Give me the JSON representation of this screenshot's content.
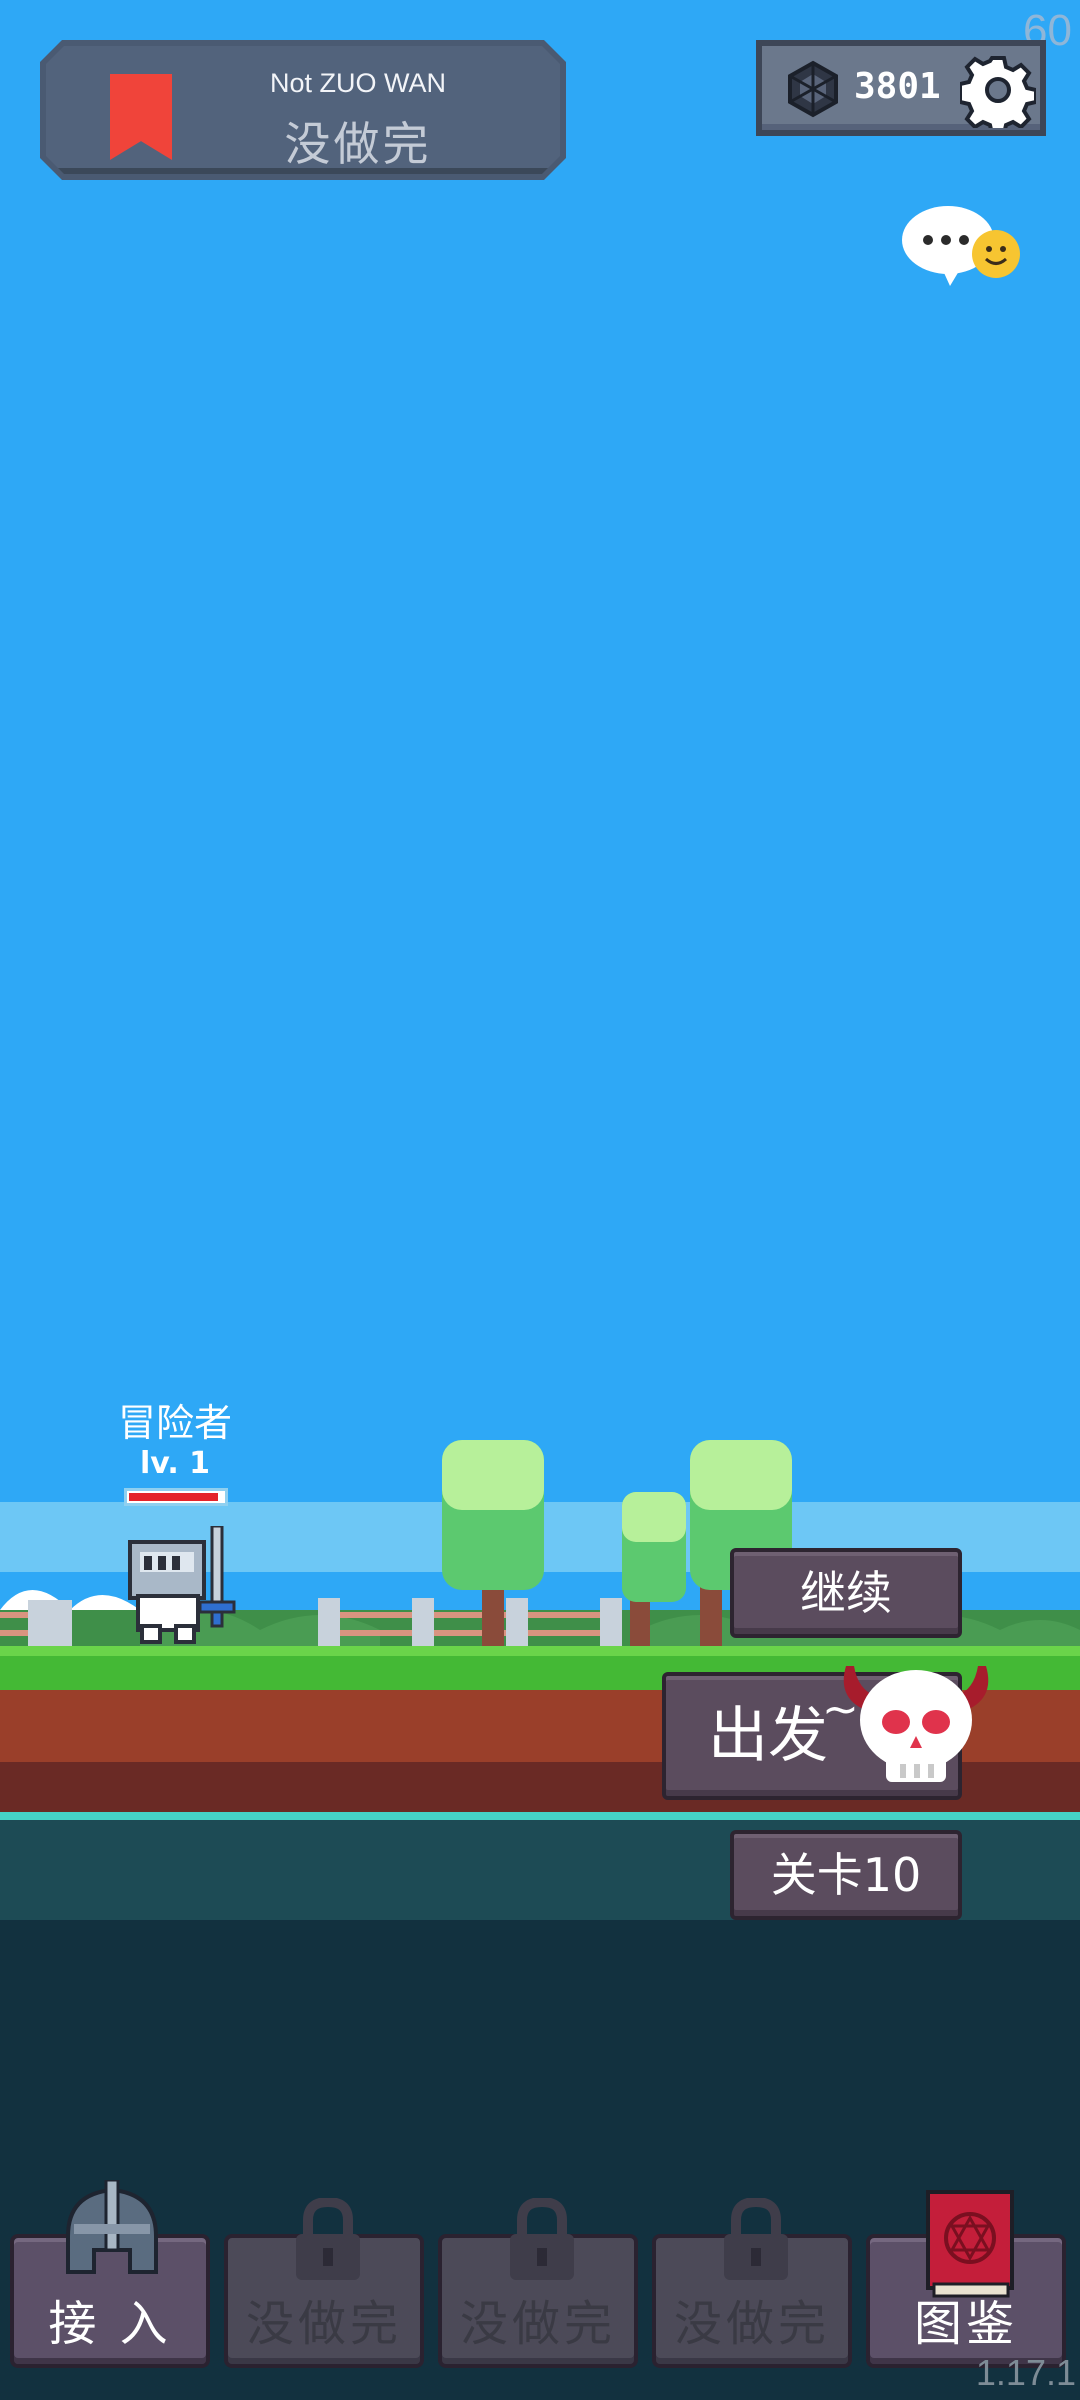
{
  "fps": "60",
  "version": "1.17.1",
  "title_panel": {
    "title_en": "Not ZUO WAN",
    "title_cn": "没做完"
  },
  "currency": {
    "value": "3801"
  },
  "character": {
    "name": "冒险者",
    "level": "lv. 1",
    "hp_fraction": 0.95
  },
  "actions": {
    "continue": "继续",
    "go": "出发",
    "go_suffix": "~",
    "stage": "关卡10"
  },
  "tabs": [
    {
      "label": "接 入",
      "icon": "helmet-icon",
      "locked": false
    },
    {
      "label": "没做完",
      "icon": "lock-icon",
      "locked": true
    },
    {
      "label": "没做完",
      "icon": "lock-icon",
      "locked": true
    },
    {
      "label": "没做完",
      "icon": "lock-icon",
      "locked": true
    },
    {
      "label": "图鉴",
      "icon": "book-icon",
      "locked": false
    }
  ],
  "colors": {
    "sky": "#2ea8f6",
    "accent_red": "#f0443a",
    "button": "#5b4c5e"
  }
}
